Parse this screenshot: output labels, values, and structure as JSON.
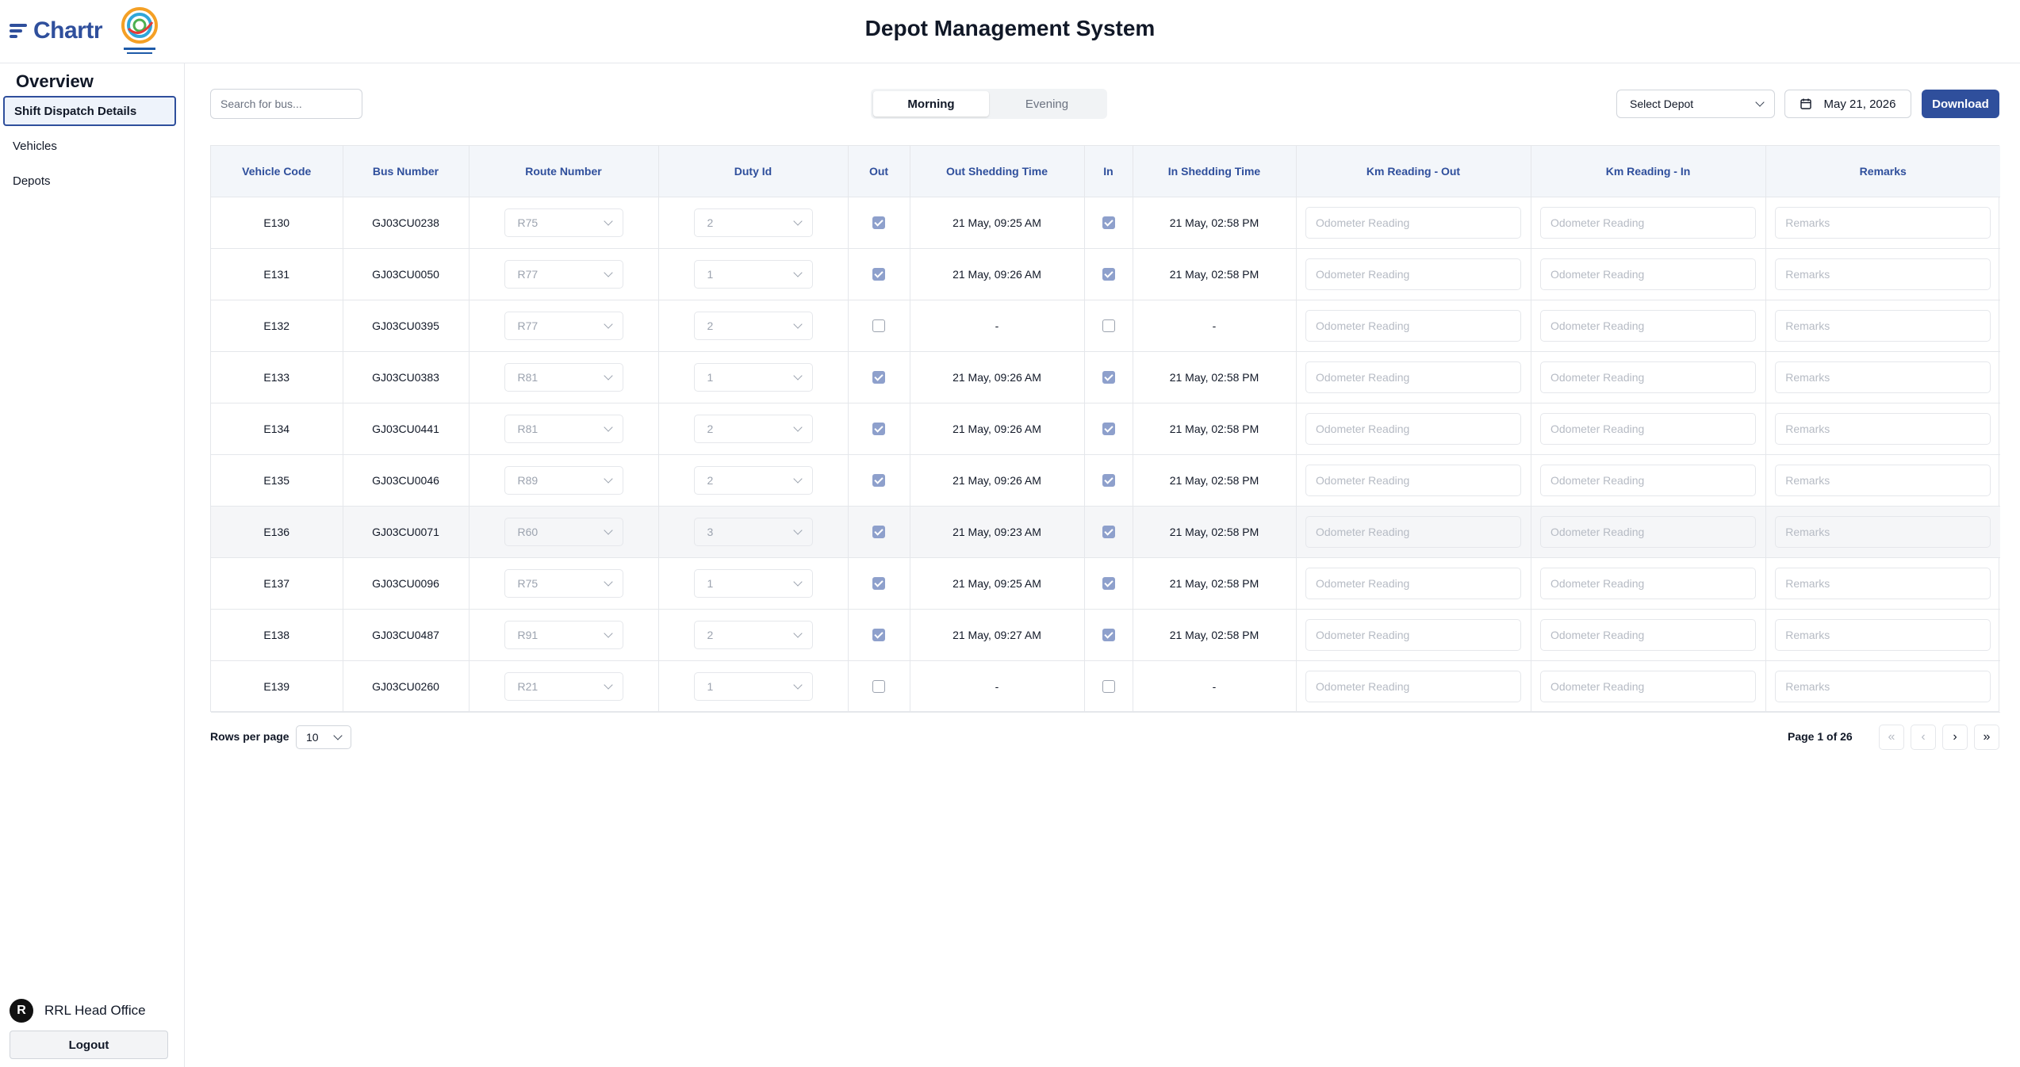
{
  "header": {
    "brand": "Chartr",
    "app_title": "Depot Management System"
  },
  "sidebar": {
    "heading": "Overview",
    "items": [
      {
        "label": "Shift Dispatch Details",
        "active": true
      },
      {
        "label": "Vehicles",
        "active": false
      },
      {
        "label": "Depots",
        "active": false
      }
    ],
    "user": {
      "initial": "R",
      "name": "RRL Head Office"
    },
    "logout_label": "Logout"
  },
  "toolbar": {
    "search_placeholder": "Search for bus...",
    "shifts": [
      {
        "label": "Morning",
        "active": true
      },
      {
        "label": "Evening",
        "active": false
      }
    ],
    "depot_select": "Select Depot",
    "date": "May 21, 2026",
    "download_label": "Download"
  },
  "table": {
    "columns": [
      "Vehicle Code",
      "Bus Number",
      "Route Number",
      "Duty Id",
      "Out",
      "Out Shedding Time",
      "In",
      "In Shedding Time",
      "Km Reading - Out",
      "Km Reading - In",
      "Remarks"
    ],
    "odometer_placeholder": "Odometer Reading",
    "remarks_placeholder": "Remarks",
    "rows": [
      {
        "vehicle": "E130",
        "bus": "GJ03CU0238",
        "route": "R75",
        "duty": "2",
        "out": true,
        "out_time": "21 May, 09:25 AM",
        "in": true,
        "in_time": "21 May, 02:58 PM"
      },
      {
        "vehicle": "E131",
        "bus": "GJ03CU0050",
        "route": "R77",
        "duty": "1",
        "out": true,
        "out_time": "21 May, 09:26 AM",
        "in": true,
        "in_time": "21 May, 02:58 PM"
      },
      {
        "vehicle": "E132",
        "bus": "GJ03CU0395",
        "route": "R77",
        "duty": "2",
        "out": false,
        "out_time": "-",
        "in": false,
        "in_time": "-"
      },
      {
        "vehicle": "E133",
        "bus": "GJ03CU0383",
        "route": "R81",
        "duty": "1",
        "out": true,
        "out_time": "21 May, 09:26 AM",
        "in": true,
        "in_time": "21 May, 02:58 PM"
      },
      {
        "vehicle": "E134",
        "bus": "GJ03CU0441",
        "route": "R81",
        "duty": "2",
        "out": true,
        "out_time": "21 May, 09:26 AM",
        "in": true,
        "in_time": "21 May, 02:58 PM"
      },
      {
        "vehicle": "E135",
        "bus": "GJ03CU0046",
        "route": "R89",
        "duty": "2",
        "out": true,
        "out_time": "21 May, 09:26 AM",
        "in": true,
        "in_time": "21 May, 02:58 PM"
      },
      {
        "vehicle": "E136",
        "bus": "GJ03CU0071",
        "route": "R60",
        "duty": "3",
        "out": true,
        "out_time": "21 May, 09:23 AM",
        "in": true,
        "in_time": "21 May, 02:58 PM",
        "highlight": true
      },
      {
        "vehicle": "E137",
        "bus": "GJ03CU0096",
        "route": "R75",
        "duty": "1",
        "out": true,
        "out_time": "21 May, 09:25 AM",
        "in": true,
        "in_time": "21 May, 02:58 PM"
      },
      {
        "vehicle": "E138",
        "bus": "GJ03CU0487",
        "route": "R91",
        "duty": "2",
        "out": true,
        "out_time": "21 May, 09:27 AM",
        "in": true,
        "in_time": "21 May, 02:58 PM"
      },
      {
        "vehicle": "E139",
        "bus": "GJ03CU0260",
        "route": "R21",
        "duty": "1",
        "out": false,
        "out_time": "-",
        "in": false,
        "in_time": "-"
      }
    ]
  },
  "pagination": {
    "rows_label": "Rows per page",
    "rows_value": "10",
    "page_info": "Page 1 of 26"
  },
  "colors": {
    "brand": "#2f4f9c",
    "header_bg": "#f3f6fa",
    "checkbox": "#8ea0cc"
  }
}
